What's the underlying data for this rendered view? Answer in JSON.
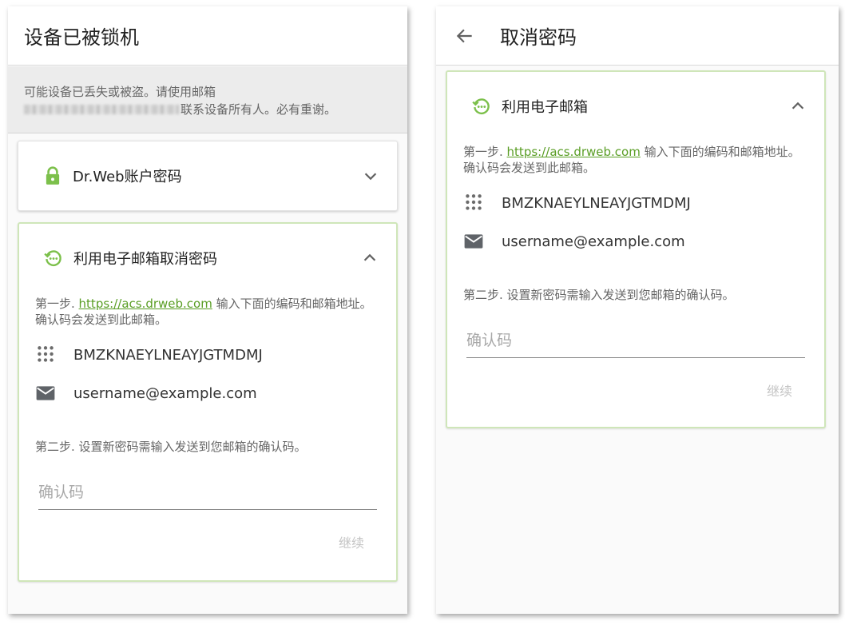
{
  "colors": {
    "accent_green": "#5a9e25",
    "card_border_green": "#cfe6b9",
    "icon_green": "#7cc04b",
    "notice_bg": "#ececec",
    "icon_grey": "#5f6368"
  },
  "left_screen": {
    "title": "设备已被锁机",
    "notice": {
      "line1": "可能设备已丢失或被盗。请使用邮箱",
      "line2_suffix": "联系设备所有人。必有重谢。"
    },
    "account_card": {
      "icon": "lock-icon",
      "title": "Dr.Web账户密码",
      "chevron": "chevron-down-icon"
    },
    "email_card": {
      "icon": "email-restore-icon",
      "title": "利用电子邮箱取消密码",
      "chevron": "chevron-up-icon",
      "step1_prefix": "第一步. ",
      "step1_link": "https://acs.drweb.com",
      "step1_suffix": " 输入下面的编码和邮箱地址。确认码会发送到此邮箱。",
      "code_icon": "dialpad-icon",
      "code": "BMZKNAEYLNEAYJGTMDMJ",
      "mail_icon": "envelope-icon",
      "email": "username@example.com",
      "step2": "第二步. 设置新密码需输入发送到您邮箱的确认码。",
      "input_placeholder": "确认码",
      "input_value": "",
      "continue_label": "继续"
    }
  },
  "right_screen": {
    "back_icon": "arrow-left-icon",
    "title": "取消密码",
    "email_card": {
      "icon": "email-restore-icon",
      "title": "利用电子邮箱",
      "chevron": "chevron-up-icon",
      "step1_prefix": "第一步. ",
      "step1_link": "https://acs.drweb.com",
      "step1_suffix": " 输入下面的编码和邮箱地址。确认码会发送到此邮箱。",
      "code_icon": "dialpad-icon",
      "code": "BMZKNAEYLNEAYJGTMDMJ",
      "mail_icon": "envelope-icon",
      "email": "username@example.com",
      "step2": "第二步. 设置新密码需输入发送到您邮箱的确认码。",
      "input_placeholder": "确认码",
      "input_value": "",
      "continue_label": "继续"
    }
  }
}
